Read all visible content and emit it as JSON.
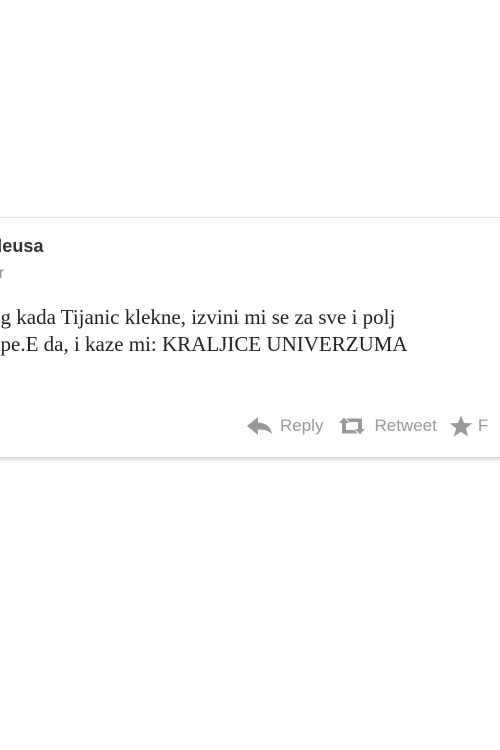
{
  "tweet": {
    "author_name": "rleusa",
    "author_handle": "ar",
    "text_lines": [
      "ng kada Tijanic klekne, izvini mi se za sve i polj",
      "upe.E da, i kaze mi: KRALJICE UNIVERZUMA"
    ]
  },
  "actions": {
    "reply_label": "Reply",
    "retweet_label": "Retweet",
    "favorite_label": "F",
    "icons": {
      "reply": "reply-arrow-icon",
      "retweet": "retweet-arrows-icon",
      "favorite": "star-icon"
    },
    "icon_color": "#999999"
  }
}
